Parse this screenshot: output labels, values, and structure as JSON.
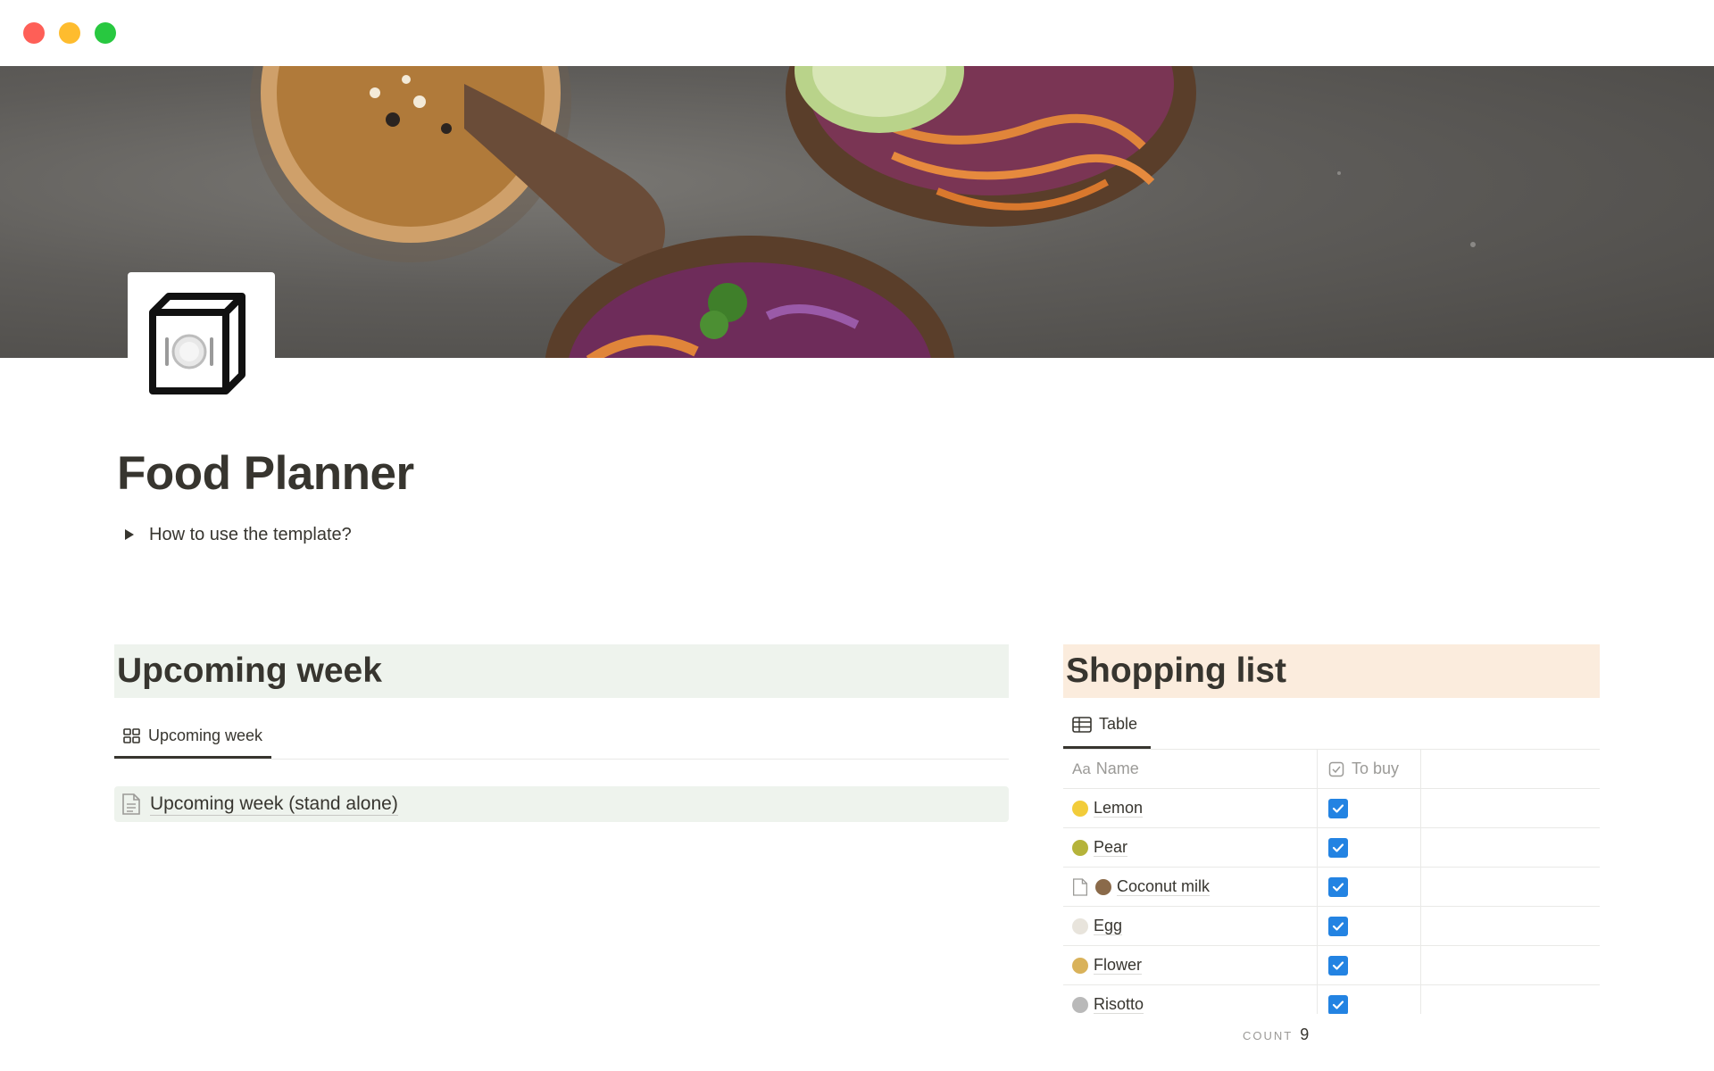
{
  "window": {
    "controls": [
      "close",
      "minimize",
      "zoom"
    ]
  },
  "cover": {
    "description_icon": "food-bowls-cover-image"
  },
  "page": {
    "icon": "plate-cube-icon",
    "title": "Food Planner",
    "toggle_text": "How to use the template?"
  },
  "upcoming": {
    "heading": "Upcoming week",
    "view_tab": "Upcoming week",
    "card_title": "Upcoming week (stand alone)"
  },
  "shopping": {
    "heading": "Shopping list",
    "view_tab": "Table",
    "columns": {
      "name_prefix": "Aa",
      "name": "Name",
      "to_buy": "To buy"
    },
    "rows": [
      {
        "name": "Lemon",
        "emoji_color": "#f2cc3a",
        "has_doc": false,
        "checked": true
      },
      {
        "name": "Pear",
        "emoji_color": "#b5b33a",
        "has_doc": false,
        "checked": true
      },
      {
        "name": "Coconut milk",
        "emoji_color": "#8a6a4a",
        "has_doc": true,
        "checked": true
      },
      {
        "name": "Egg",
        "emoji_color": "#e8e4dc",
        "has_doc": false,
        "checked": true
      },
      {
        "name": "Flower",
        "emoji_color": "#d9b25a",
        "has_doc": false,
        "checked": true
      },
      {
        "name": "Risotto",
        "emoji_color": "#b9b9b9",
        "has_doc": false,
        "checked": true
      }
    ],
    "count_label": "COUNT",
    "count_value": "9"
  },
  "colors": {
    "accent_checkbox": "#2383e2",
    "upcoming_bg": "#eef3ed",
    "shopping_bg": "#fbecdd"
  }
}
